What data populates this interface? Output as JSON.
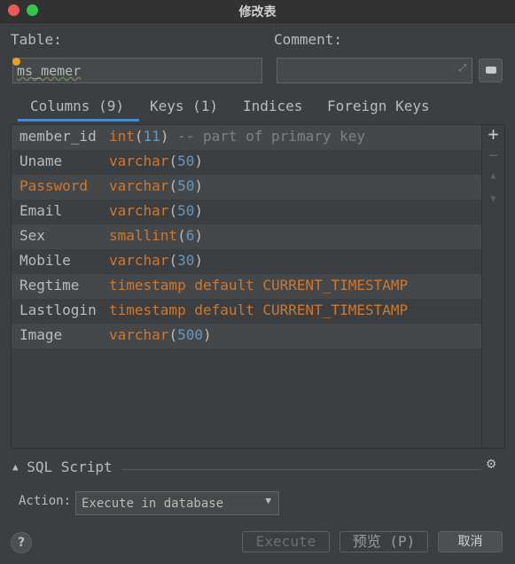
{
  "window": {
    "title": "修改表"
  },
  "labels": {
    "table": "Table:",
    "comment": "Comment:"
  },
  "table_name": "ms_memer",
  "comment_value": "",
  "tabs": [
    {
      "label": "Columns (9)",
      "active": true
    },
    {
      "label": "Keys (1)",
      "active": false
    },
    {
      "label": "Indices",
      "active": false
    },
    {
      "label": "Foreign Keys",
      "active": false
    }
  ],
  "columns": [
    {
      "name": "member_id",
      "type": "int",
      "size": "11",
      "comment": "-- part of primary key"
    },
    {
      "name": "Uname",
      "type": "varchar",
      "size": "50"
    },
    {
      "name": "Password",
      "type": "varchar",
      "size": "50"
    },
    {
      "name": "Email",
      "type": "varchar",
      "size": "50"
    },
    {
      "name": "Sex",
      "type": "smallint",
      "size": "6"
    },
    {
      "name": "Mobile",
      "type": "varchar",
      "size": "30"
    },
    {
      "name": "Regtime",
      "type": "timestamp default CURRENT_TIMESTAMP"
    },
    {
      "name": "Lastlogin",
      "type": "timestamp default CURRENT_TIMESTAMP"
    },
    {
      "name": "Image",
      "type": "varchar",
      "size": "500"
    }
  ],
  "side_toolbar": {
    "add": "+",
    "remove": "−",
    "up": "▲",
    "down": "▼"
  },
  "sql": {
    "header": "SQL Script",
    "action_label": "Action:",
    "action_value": "Execute in database"
  },
  "buttons": {
    "help": "?",
    "execute": "Execute",
    "preview": "预览 (P)",
    "cancel": "取消"
  },
  "icons": {
    "collapse": "triangle-up-icon",
    "settings": "gear-icon",
    "expand": "expand-icon",
    "comment": "comment-icon"
  }
}
